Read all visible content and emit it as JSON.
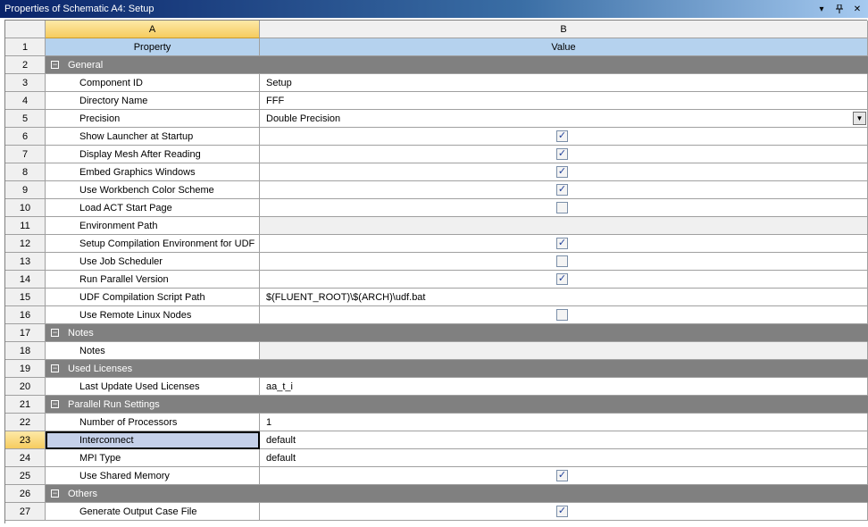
{
  "window": {
    "title": "Properties of Schematic A4: Setup"
  },
  "columns": {
    "a": "A",
    "b": "B"
  },
  "header_row": {
    "num": "1",
    "property": "Property",
    "value": "Value"
  },
  "rows": [
    {
      "num": "2",
      "type": "section",
      "label": "General",
      "toggle": "−"
    },
    {
      "num": "3",
      "type": "text",
      "label": "Component ID",
      "value": "Setup"
    },
    {
      "num": "4",
      "type": "text",
      "label": "Directory Name",
      "value": "FFF"
    },
    {
      "num": "5",
      "type": "dropdown",
      "label": "Precision",
      "value": "Double Precision"
    },
    {
      "num": "6",
      "type": "check",
      "label": "Show Launcher at Startup",
      "checked": true
    },
    {
      "num": "7",
      "type": "check",
      "label": "Display Mesh After Reading",
      "checked": true
    },
    {
      "num": "8",
      "type": "check",
      "label": "Embed Graphics Windows",
      "checked": true
    },
    {
      "num": "9",
      "type": "check",
      "label": "Use Workbench Color Scheme",
      "checked": true
    },
    {
      "num": "10",
      "type": "check",
      "label": "Load ACT Start Page",
      "checked": false
    },
    {
      "num": "11",
      "type": "disabled",
      "label": "Environment Path",
      "value": ""
    },
    {
      "num": "12",
      "type": "check",
      "label": "Setup Compilation Environment for UDF",
      "checked": true
    },
    {
      "num": "13",
      "type": "check",
      "label": "Use Job Scheduler",
      "checked": false
    },
    {
      "num": "14",
      "type": "check",
      "label": "Run Parallel Version",
      "checked": true
    },
    {
      "num": "15",
      "type": "text",
      "label": "UDF Compilation Script Path",
      "value": "$(FLUENT_ROOT)\\$(ARCH)\\udf.bat"
    },
    {
      "num": "16",
      "type": "check",
      "label": "Use Remote Linux Nodes",
      "checked": false
    },
    {
      "num": "17",
      "type": "section",
      "label": "Notes",
      "toggle": "−"
    },
    {
      "num": "18",
      "type": "disabled",
      "label": "Notes",
      "value": ""
    },
    {
      "num": "19",
      "type": "section",
      "label": "Used Licenses",
      "toggle": "−"
    },
    {
      "num": "20",
      "type": "text",
      "label": "Last Update Used Licenses",
      "value": "aa_t_i"
    },
    {
      "num": "21",
      "type": "section",
      "label": "Parallel Run Settings",
      "toggle": "−"
    },
    {
      "num": "22",
      "type": "text",
      "label": "Number of Processors",
      "value": "1"
    },
    {
      "num": "23",
      "type": "text",
      "label": "Interconnect",
      "value": "default",
      "selected": true
    },
    {
      "num": "24",
      "type": "text",
      "label": "MPI Type",
      "value": "default"
    },
    {
      "num": "25",
      "type": "check",
      "label": "Use Shared Memory",
      "checked": true
    },
    {
      "num": "26",
      "type": "section",
      "label": "Others",
      "toggle": "−"
    },
    {
      "num": "27",
      "type": "check",
      "label": "Generate Output Case File",
      "checked": true
    }
  ],
  "icons": {
    "dropdown": "▼",
    "pin": "ᵖ",
    "close": "✕",
    "menu": "▾",
    "check": "✓"
  },
  "colors": {
    "section_bg": "#808080",
    "column_header_bg": "#b5d2ee",
    "selected_bg": "#c5d0e9",
    "active_header": "#f6cc5e"
  }
}
